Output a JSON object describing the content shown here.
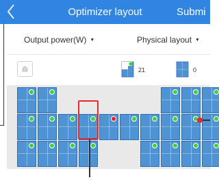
{
  "header": {
    "title": "Optimizer layout",
    "submit_label": "Submi"
  },
  "filters": {
    "output_power": "Output power(W)",
    "layout": "Physical layout"
  },
  "toolbar": {
    "online_count": "21",
    "offline_count": "0"
  },
  "colors": {
    "header_bg": "#2f85e0",
    "panel": "#4f93d3",
    "status_ok": "#39d339",
    "status_selected": "#ee1c25",
    "selection": "#e8282e"
  },
  "icons": {
    "back": "chevron-left-icon",
    "dropdown": "caret-down-icon",
    "home": "home-icon",
    "online_optimizer": "optimizer-online-icon",
    "offline_optimizer": "optimizer-offline-icon",
    "status": "status-dot-icon"
  },
  "panel_grid": {
    "rows": [
      [
        "ok",
        "ok",
        "",
        "",
        "",
        "",
        "",
        "ok",
        "ok",
        "ok",
        "ok"
      ],
      [
        "ok",
        "ok",
        "ok",
        "ok",
        "selected",
        "ok",
        "ok",
        "ok",
        "ok",
        "ok",
        "ok"
      ],
      [
        "ok",
        "ok",
        "ok",
        "ok",
        "",
        "",
        "ok",
        "ok",
        "ok",
        "ok",
        "ok"
      ]
    ]
  }
}
